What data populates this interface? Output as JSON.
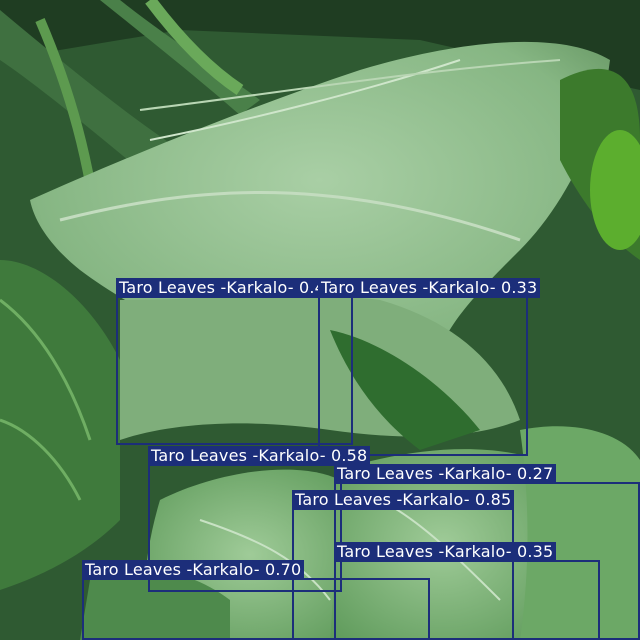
{
  "image": {
    "description_colors": {
      "box": "#1c2e7a",
      "label_text": "#ffffff",
      "leaf_light": "#9cc49a",
      "leaf_mid": "#6f9e6c",
      "leaf_dark": "#2f5a32"
    }
  },
  "detections": [
    {
      "label": "Taro Leaves -Karkalo-",
      "score": "0.41"
    },
    {
      "label": "Taro Leaves -Karkalo-",
      "score": "0.33"
    },
    {
      "label": "Taro Leaves -Karkalo-",
      "score": "0.58"
    },
    {
      "label": "Taro Leaves -Karkalo-",
      "score": "0.27"
    },
    {
      "label": "Taro Leaves -Karkalo-",
      "score": "0.85"
    },
    {
      "label": "Taro Leaves -Karkalo-",
      "score": "0.35"
    },
    {
      "label": "Taro Leaves -Karkalo-",
      "score": "0.70"
    }
  ]
}
